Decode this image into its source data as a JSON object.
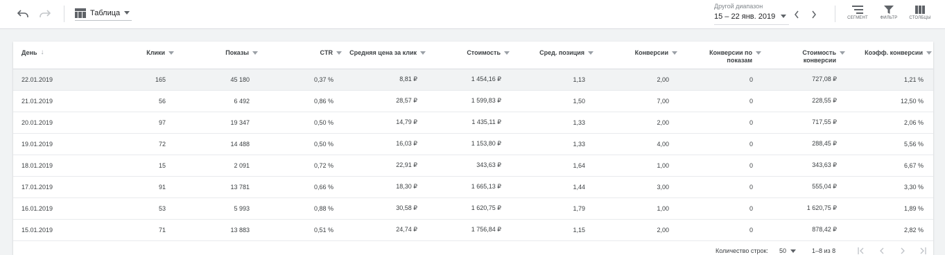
{
  "toolbar": {
    "undo_icon": "undo-icon",
    "redo_icon": "redo-icon",
    "view_icon": "table-icon",
    "view_label": "Таблица",
    "range_caption": "Другой диапазон",
    "range_value": "15 – 22 янв. 2019",
    "segment_label": "СЕГМЕНТ",
    "filter_label": "ФИЛЬТР",
    "columns_label": "СТОЛБЦЫ"
  },
  "table": {
    "headers": {
      "day": "День",
      "clicks": "Клики",
      "impressions": "Показы",
      "ctr": "CTR",
      "avg_cpc": "Средняя цена за клик",
      "cost": "Стоимость",
      "avg_pos": "Сред. позиция",
      "conversions": "Конверсии",
      "view_conv": "Конверсии по показам",
      "cost_conv": "Стоимость конверсии",
      "conv_rate": "Коэфф. конверсии"
    },
    "rows": [
      {
        "day": "22.01.2019",
        "clicks": "165",
        "impr": "45 180",
        "ctr": "0,37 %",
        "cpc": "8,81 ₽",
        "cost": "1 454,16 ₽",
        "pos": "1,13",
        "conv": "2,00",
        "vconv": "0",
        "cconv": "727,08 ₽",
        "rate": "1,21 %"
      },
      {
        "day": "21.01.2019",
        "clicks": "56",
        "impr": "6 492",
        "ctr": "0,86 %",
        "cpc": "28,57 ₽",
        "cost": "1 599,83 ₽",
        "pos": "1,50",
        "conv": "7,00",
        "vconv": "0",
        "cconv": "228,55 ₽",
        "rate": "12,50 %"
      },
      {
        "day": "20.01.2019",
        "clicks": "97",
        "impr": "19 347",
        "ctr": "0,50 %",
        "cpc": "14,79 ₽",
        "cost": "1 435,11 ₽",
        "pos": "1,33",
        "conv": "2,00",
        "vconv": "0",
        "cconv": "717,55 ₽",
        "rate": "2,06 %"
      },
      {
        "day": "19.01.2019",
        "clicks": "72",
        "impr": "14 488",
        "ctr": "0,50 %",
        "cpc": "16,03 ₽",
        "cost": "1 153,80 ₽",
        "pos": "1,33",
        "conv": "4,00",
        "vconv": "0",
        "cconv": "288,45 ₽",
        "rate": "5,56 %"
      },
      {
        "day": "18.01.2019",
        "clicks": "15",
        "impr": "2 091",
        "ctr": "0,72 %",
        "cpc": "22,91 ₽",
        "cost": "343,63 ₽",
        "pos": "1,64",
        "conv": "1,00",
        "vconv": "0",
        "cconv": "343,63 ₽",
        "rate": "6,67 %"
      },
      {
        "day": "17.01.2019",
        "clicks": "91",
        "impr": "13 781",
        "ctr": "0,66 %",
        "cpc": "18,30 ₽",
        "cost": "1 665,13 ₽",
        "pos": "1,44",
        "conv": "3,00",
        "vconv": "0",
        "cconv": "555,04 ₽",
        "rate": "3,30 %"
      },
      {
        "day": "16.01.2019",
        "clicks": "53",
        "impr": "5 993",
        "ctr": "0,88 %",
        "cpc": "30,58 ₽",
        "cost": "1 620,75 ₽",
        "pos": "1,79",
        "conv": "1,00",
        "vconv": "0",
        "cconv": "1 620,75 ₽",
        "rate": "1,89 %"
      },
      {
        "day": "15.01.2019",
        "clicks": "71",
        "impr": "13 883",
        "ctr": "0,51 %",
        "cpc": "24,74 ₽",
        "cost": "1 756,84 ₽",
        "pos": "1,15",
        "conv": "2,00",
        "vconv": "0",
        "cconv": "878,42 ₽",
        "rate": "2,82 %"
      }
    ]
  },
  "footer": {
    "rows_label": "Количество строк:",
    "rows_value": "50",
    "range_text": "1–8 из 8"
  }
}
